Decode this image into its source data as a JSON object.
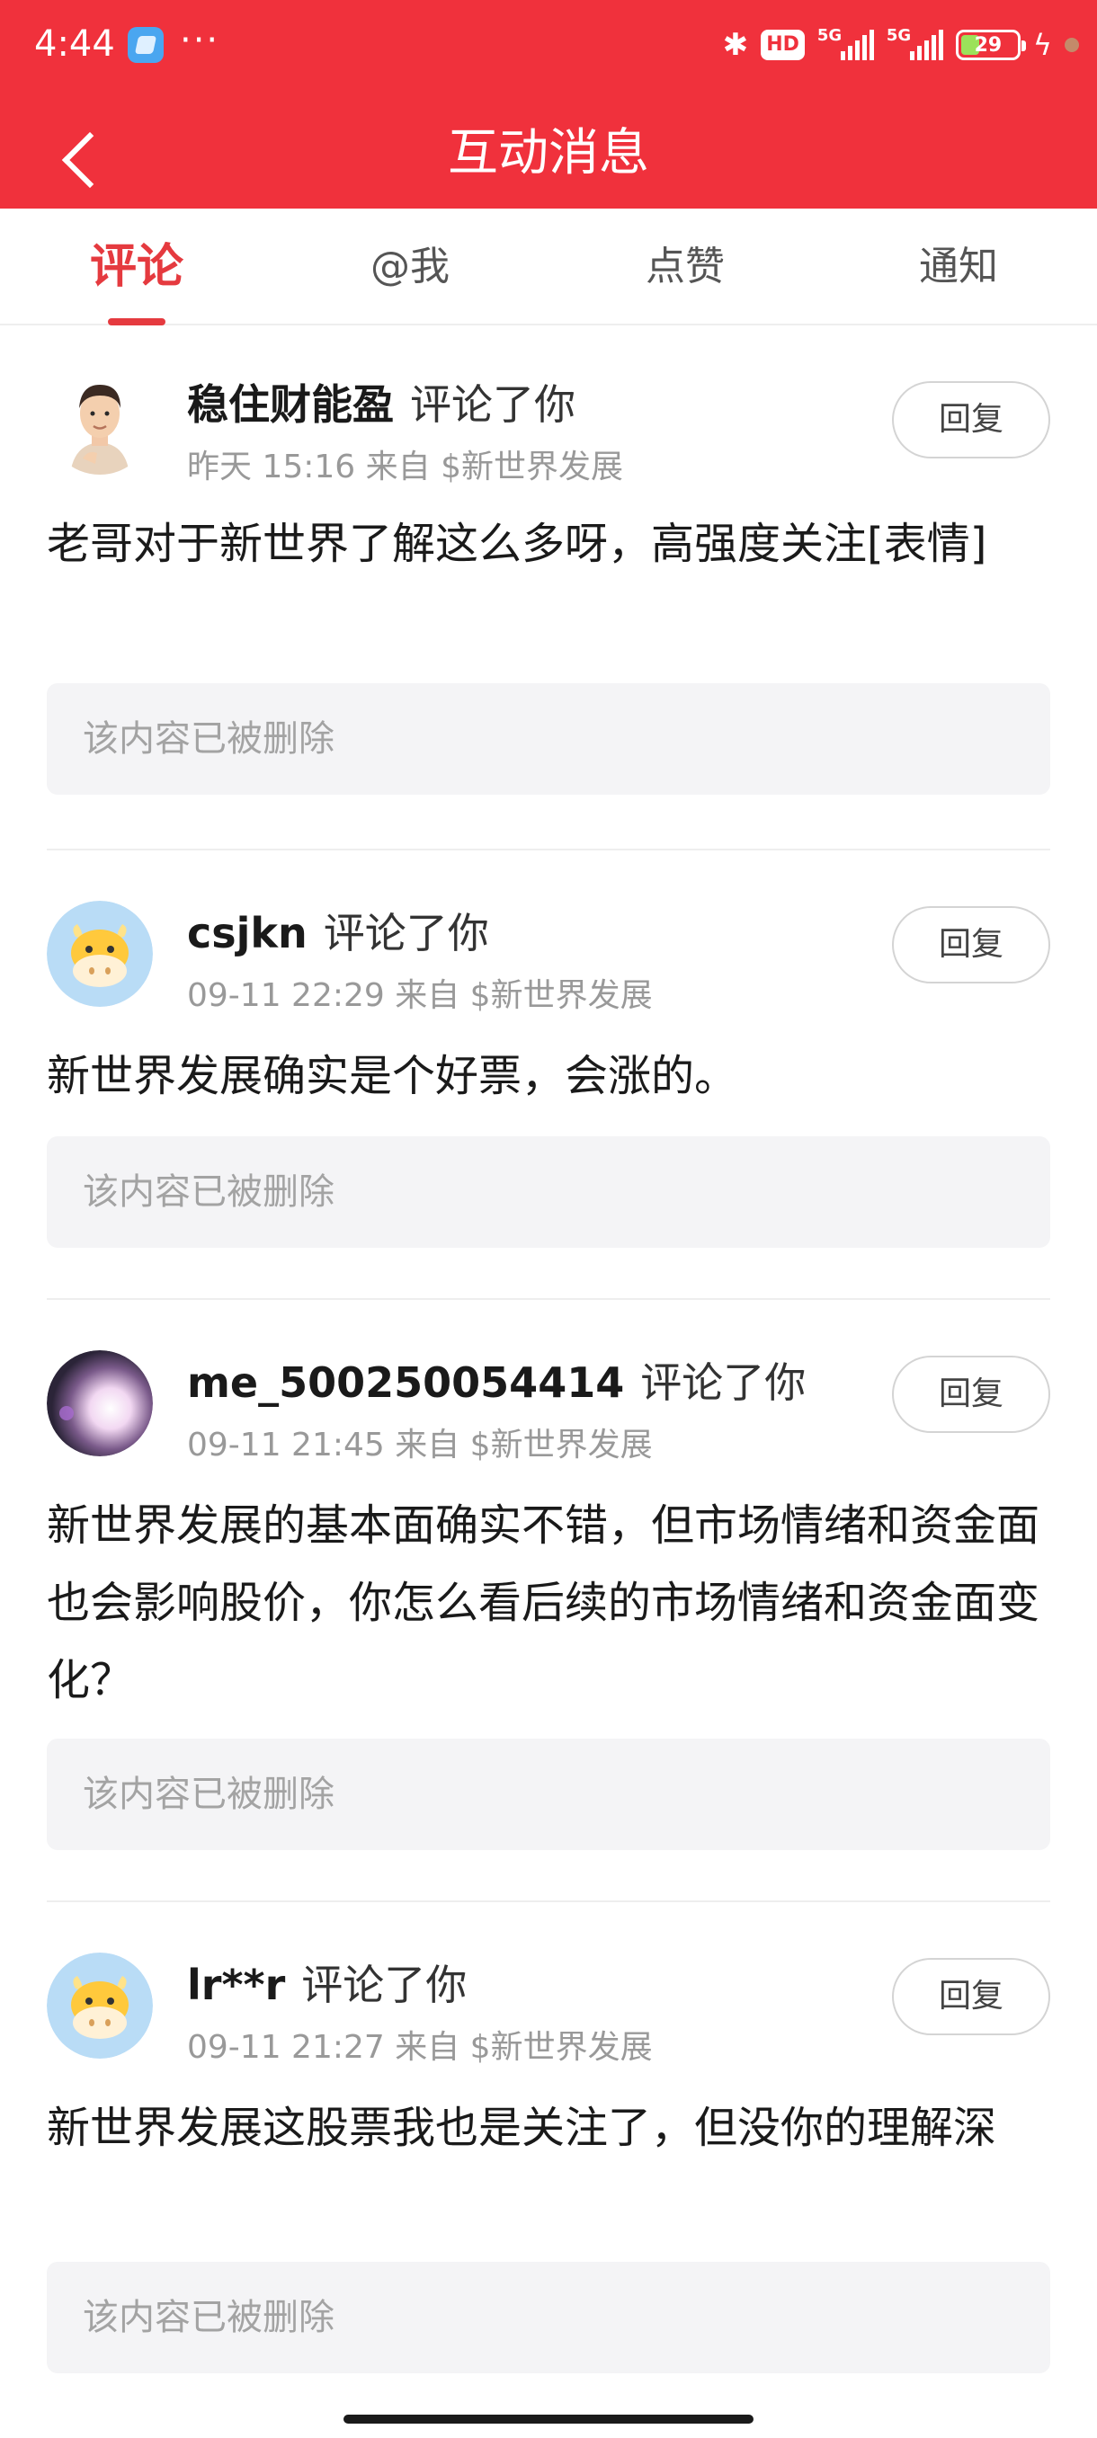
{
  "status_bar": {
    "time": "4:44",
    "dots": "···",
    "hd_badge": "HD",
    "signal1": "5G",
    "signal2": "5G",
    "battery": "29"
  },
  "header": {
    "title": "互动消息",
    "back_icon": "chevron-left-icon"
  },
  "tabs": [
    {
      "label": "评论",
      "active": true
    },
    {
      "label": "@我",
      "active": false
    },
    {
      "label": "点赞",
      "active": false
    },
    {
      "label": "通知",
      "active": false
    }
  ],
  "comments": [
    {
      "user": "稳住财能盈",
      "action": "评论了你",
      "meta": "昨天 15:16 来自 $新世界发展",
      "text": "老哥对于新世界了解这么多呀，高强度关注[表情]",
      "deleted": "该内容已被删除",
      "reply": "回复",
      "avatar": "memoji-avatar"
    },
    {
      "user": "csjkn",
      "action": "评论了你",
      "meta": "09-11 22:29 来自 $新世界发展",
      "text": "新世界发展确实是个好票，会涨的。",
      "deleted": "该内容已被删除",
      "reply": "回复",
      "avatar": "cow-avatar"
    },
    {
      "user": "me_500250054414",
      "action": "评论了你",
      "meta": "09-11 21:45 来自 $新世界发展",
      "text": "新世界发展的基本面确实不错，但市场情绪和资金面也会影响股价，你怎么看后续的市场情绪和资金面变化？",
      "deleted": "该内容已被删除",
      "reply": "回复",
      "avatar": "photo-avatar"
    },
    {
      "user": "lr**r",
      "action": "评论了你",
      "meta": "09-11 21:27 来自 $新世界发展",
      "text": "新世界发展这股票我也是关注了，但没你的理解深",
      "deleted": "该内容已被删除",
      "reply": "回复",
      "avatar": "cow-avatar"
    }
  ],
  "colors": {
    "brand_red": "#f0313c",
    "tab_active": "#e53a3f",
    "muted_text": "#999999",
    "deleted_bg": "#f4f4f6"
  }
}
